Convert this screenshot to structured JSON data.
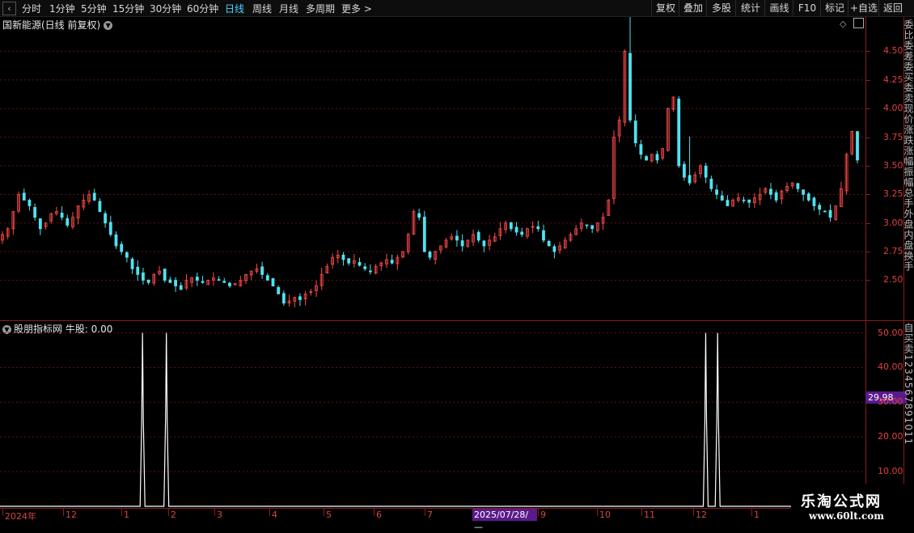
{
  "toolbar": {
    "back_icon": "chevron-left-icon",
    "periods": [
      "分时",
      "1分钟",
      "5分钟",
      "15分钟",
      "30分钟",
      "60分钟",
      "日线",
      "周线",
      "月线",
      "多周期",
      "更多 >"
    ],
    "active_period": "日线",
    "right_buttons": [
      "复权",
      "叠加",
      "多股",
      "统计",
      "画线",
      "F10",
      "标记",
      "+自选",
      "返回"
    ]
  },
  "main_chart": {
    "title": "国新能源(日线 前复权)",
    "y_ticks": [
      "4.50",
      "4.25",
      "4.00",
      "3.75",
      "3.50",
      "3.25",
      "3.00",
      "2.75",
      "2.50"
    ],
    "up_color": "#ff4a4a",
    "down_color": "#4fe3f0"
  },
  "sub_chart": {
    "title": "股朋指标网 牛股: 0.00",
    "y_ticks": [
      "50.00",
      "40.00",
      "30.00",
      "20.00",
      "10.00"
    ],
    "cursor_value": "29.98"
  },
  "right_panel": {
    "text_top": "委比委差委买委卖现价涨跌涨幅振幅总手外盘内盘换手",
    "text_bottom": "自买卖1234567891011"
  },
  "date_axis": {
    "labels": [
      "2024年",
      "12",
      "1",
      "2",
      "3",
      "4",
      "5",
      "6",
      "7",
      "9",
      "10",
      "11",
      "12",
      "1"
    ],
    "cursor_date": "2025/07/28/—"
  },
  "watermark": {
    "line1": "乐淘公式网",
    "line2": "www.60lt.com"
  },
  "chart_data": [
    {
      "type": "candlestick",
      "title": "国新能源(日线 前复权)",
      "ylim": [
        2.15,
        4.8
      ],
      "y_ticks": [
        2.5,
        2.75,
        3.0,
        3.25,
        3.5,
        3.75,
        4.0,
        4.25,
        4.5
      ],
      "grid": true,
      "x_labels": [
        "2024年",
        "12",
        "1",
        "2",
        "3",
        "4",
        "5",
        "6",
        "7",
        "9",
        "10",
        "11",
        "12",
        "1"
      ],
      "close_series": [
        2.9,
        2.95,
        3.1,
        3.25,
        3.2,
        3.15,
        3.05,
        2.95,
        3.0,
        3.08,
        3.1,
        3.05,
        2.98,
        3.05,
        3.15,
        3.2,
        3.25,
        3.2,
        3.1,
        3.0,
        2.9,
        2.8,
        2.75,
        2.7,
        2.6,
        2.55,
        2.5,
        2.48,
        2.55,
        2.58,
        2.5,
        2.48,
        2.45,
        2.42,
        2.5,
        2.52,
        2.5,
        2.48,
        2.5,
        2.52,
        2.5,
        2.48,
        2.45,
        2.47,
        2.5,
        2.55,
        2.58,
        2.6,
        2.55,
        2.5,
        2.45,
        2.38,
        2.3,
        2.32,
        2.35,
        2.33,
        2.38,
        2.4,
        2.45,
        2.55,
        2.62,
        2.7,
        2.72,
        2.68,
        2.65,
        2.67,
        2.63,
        2.6,
        2.58,
        2.62,
        2.65,
        2.68,
        2.65,
        2.7,
        2.75,
        2.9,
        3.1,
        3.05,
        2.75,
        2.7,
        2.75,
        2.8,
        2.85,
        2.88,
        2.85,
        2.8,
        2.85,
        2.9,
        2.85,
        2.8,
        2.85,
        2.88,
        2.95,
        3.0,
        2.95,
        2.92,
        2.9,
        2.95,
        2.97,
        2.95,
        2.85,
        2.8,
        2.75,
        2.8,
        2.85,
        2.9,
        2.95,
        3.0,
        2.98,
        2.95,
        3.0,
        3.05,
        3.2,
        3.75,
        3.9,
        4.5,
        3.9,
        3.7,
        3.6,
        3.55,
        3.6,
        3.55,
        3.65,
        4.0,
        4.1,
        3.5,
        3.4,
        3.35,
        3.42,
        3.5,
        3.4,
        3.3,
        3.25,
        3.2,
        3.15,
        3.2,
        3.22,
        3.2,
        3.18,
        3.22,
        3.25,
        3.3,
        3.25,
        3.2,
        3.28,
        3.32,
        3.35,
        3.3,
        3.25,
        3.2,
        3.15,
        3.12,
        3.1,
        3.05,
        3.15,
        3.3,
        3.6,
        3.8,
        3.55
      ]
    },
    {
      "type": "line",
      "title": "股朋指标网 牛股: 0.00",
      "ylim": [
        0,
        52
      ],
      "y_ticks": [
        10,
        20,
        30,
        40,
        50
      ],
      "series": [
        {
          "name": "牛股",
          "spikes": [
            {
              "index": 47,
              "value": 50
            },
            {
              "index": 55,
              "value": 50
            },
            {
              "index": 236,
              "value": 50
            },
            {
              "index": 240,
              "value": 50
            }
          ],
          "baseline": 0,
          "total": 260
        }
      ]
    }
  ]
}
